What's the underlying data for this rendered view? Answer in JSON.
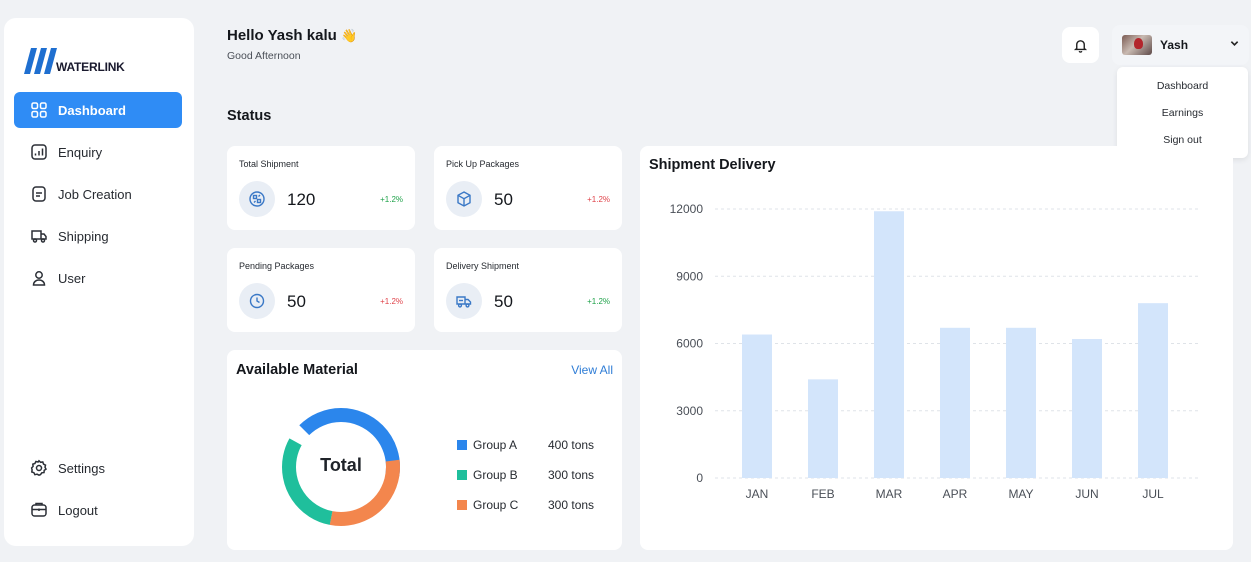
{
  "brand": {
    "name": "WATERLINK"
  },
  "sidebar": {
    "items": [
      {
        "label": "Dashboard",
        "icon": "grid-icon",
        "active": true
      },
      {
        "label": "Enquiry",
        "icon": "chart-icon"
      },
      {
        "label": "Job Creation",
        "icon": "document-icon"
      },
      {
        "label": "Shipping",
        "icon": "truck-icon"
      },
      {
        "label": "User",
        "icon": "user-icon"
      }
    ],
    "bottom": [
      {
        "label": "Settings",
        "icon": "gear-icon"
      },
      {
        "label": "Logout",
        "icon": "logout-icon"
      }
    ]
  },
  "header": {
    "greeting": "Hello Yash kalu",
    "wave": "👋",
    "subtitle": "Good Afternoon",
    "user_name": "Yash"
  },
  "user_menu": [
    "Dashboard",
    "Earnings",
    "Sign out"
  ],
  "status": {
    "title": "Status",
    "cards": [
      {
        "label": "Total Shipment",
        "value": "120",
        "change": "+1.2%",
        "trend": "up",
        "icon": "shipment-icon"
      },
      {
        "label": "Pick Up Packages",
        "value": "50",
        "change": "+1.2%",
        "trend": "down",
        "icon": "package-icon"
      },
      {
        "label": "Pending Packages",
        "value": "50",
        "change": "+1.2%",
        "trend": "down",
        "icon": "clock-icon"
      },
      {
        "label": "Delivery Shipment",
        "value": "50",
        "change": "+1.2%",
        "trend": "up",
        "icon": "delivery-icon"
      }
    ]
  },
  "material": {
    "title": "Available Material",
    "view_all": "View All",
    "center_label": "Total",
    "groups": [
      {
        "name": "Group A",
        "amount": "400 tons",
        "color": "#2b86ec"
      },
      {
        "name": "Group B",
        "amount": "300 tons",
        "color": "#1fbf9c"
      },
      {
        "name": "Group C",
        "amount": "300 tons",
        "color": "#f3864d"
      }
    ]
  },
  "chart_data": {
    "type": "bar",
    "title": "Shipment Delivery",
    "categories": [
      "JAN",
      "FEB",
      "MAR",
      "APR",
      "MAY",
      "JUN",
      "JUL"
    ],
    "values": [
      6400,
      4400,
      11900,
      6700,
      6700,
      6200,
      7800
    ],
    "yticks": [
      0,
      3000,
      6000,
      9000,
      12000
    ],
    "ylim": [
      0,
      12000
    ],
    "grid": true,
    "bar_color": "#d3e5fb"
  }
}
